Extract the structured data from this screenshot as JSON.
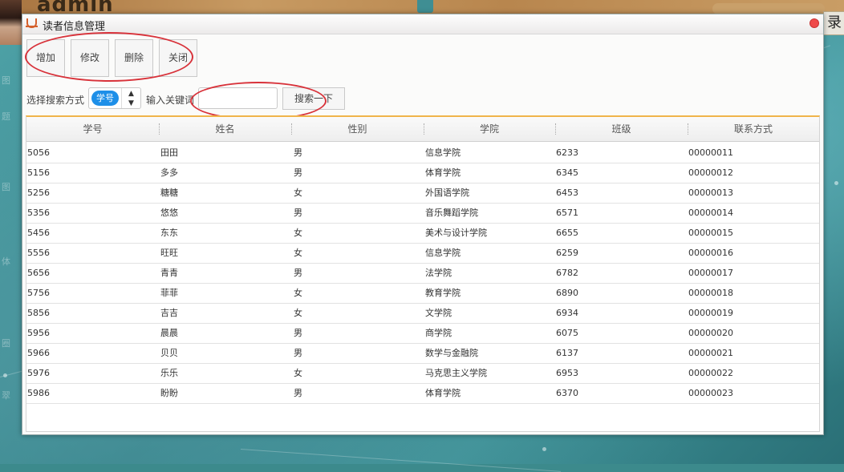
{
  "desktop": {
    "admin_text": "admin",
    "right_badge": "录",
    "side_texts": [
      "图",
      "题",
      "图",
      "体",
      "圈",
      "翠"
    ]
  },
  "window": {
    "title": "读者信息管理"
  },
  "toolbar": {
    "add_label": "增加",
    "edit_label": "修改",
    "delete_label": "删除",
    "close_label": "关闭"
  },
  "search": {
    "mode_label": "选择搜索方式",
    "mode_value": "学号",
    "keyword_label": "输入关键词",
    "keyword_value": "",
    "button_label": "搜索一下"
  },
  "table": {
    "headers": [
      "学号",
      "姓名",
      "性别",
      "学院",
      "班级",
      "联系方式"
    ],
    "rows": [
      [
        "5056",
        "田田",
        "男",
        "信息学院",
        "6233",
        "00000011"
      ],
      [
        "5156",
        "多多",
        "男",
        "体育学院",
        "6345",
        "00000012"
      ],
      [
        "5256",
        "糖糖",
        "女",
        "外国语学院",
        "6453",
        "00000013"
      ],
      [
        "5356",
        "悠悠",
        "男",
        "音乐舞蹈学院",
        "6571",
        "00000014"
      ],
      [
        "5456",
        "东东",
        "女",
        "美术与设计学院",
        "6655",
        "00000015"
      ],
      [
        "5556",
        "旺旺",
        "女",
        "信息学院",
        "6259",
        "00000016"
      ],
      [
        "5656",
        "青青",
        "男",
        "法学院",
        "6782",
        "00000017"
      ],
      [
        "5756",
        "菲菲",
        "女",
        "教育学院",
        "6890",
        "00000018"
      ],
      [
        "5856",
        "吉吉",
        "女",
        "文学院",
        "6934",
        "00000019"
      ],
      [
        "5956",
        "晨晨",
        "男",
        "商学院",
        "6075",
        "00000020"
      ],
      [
        "5966",
        "贝贝",
        "男",
        "数学与金融院",
        "6137",
        "00000021"
      ],
      [
        "5976",
        "乐乐",
        "女",
        "马克思主义学院",
        "6953",
        "00000022"
      ],
      [
        "5986",
        "盼盼",
        "男",
        "体育学院",
        "6370",
        "00000023"
      ]
    ]
  },
  "colors": {
    "highlight_ring": "#d8323a",
    "select_chip": "#1e8fe8",
    "table_accent": "#f0b44a",
    "close_button": "#ef4a4a"
  }
}
